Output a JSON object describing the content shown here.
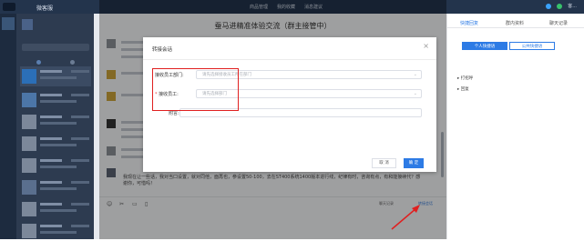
{
  "topbar": {
    "app_name": "微客服",
    "nav": [
      "商品管理",
      "我的收藏",
      "消息建议"
    ],
    "user": "客..."
  },
  "chat": {
    "title": "蚕马进精准体验交流（群主接管中）",
    "last_message": "我现在让一些话，我对当口设置，就对同他，面再也，参设置50-100，去在ST400系统1400版本进行线，纪律有时，咨询有点，有和能接续代？感谢你，可惜吗！",
    "toolbar": {
      "history": "聊天记录",
      "transfer": "转接会话"
    }
  },
  "right_panel": {
    "tabs": [
      "快捷回复",
      "群内资料",
      "聊天记录"
    ],
    "buttons": [
      "个人快捷语",
      "公共快捷语"
    ],
    "items": [
      "打招呼",
      "回复"
    ]
  },
  "modal": {
    "title": "转接会话",
    "close": "×",
    "fields": [
      {
        "label": "接收员工部门:",
        "placeholder": "请先选择接收员工所在部门",
        "required": false
      },
      {
        "label": "接收员工:",
        "placeholder": "请先选择部门",
        "required": true
      },
      {
        "label": "附言:",
        "placeholder": "",
        "required": false
      }
    ],
    "cancel": "取 消",
    "confirm": "确 定"
  },
  "colors": {
    "topbar": "#23344c",
    "accent": "#2d7be5",
    "highlight": "#e02020"
  }
}
